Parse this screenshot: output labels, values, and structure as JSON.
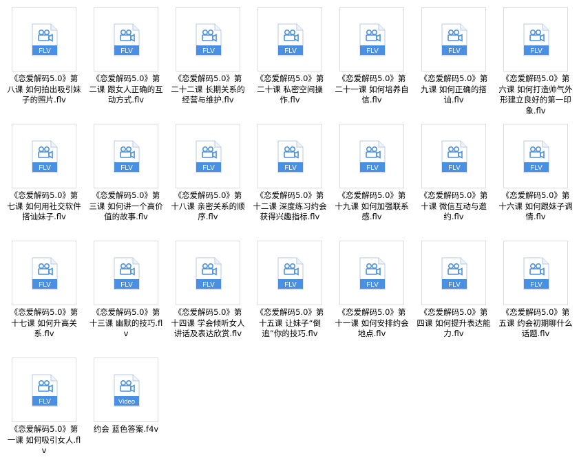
{
  "colors": {
    "icon_band": "#4a90e2",
    "icon_glyph": "#4a90e2",
    "icon_page": "#ffffff",
    "icon_border": "#b7c9e2"
  },
  "files": [
    {
      "icon": "film-camera-icon",
      "badge": "FLV",
      "name": "《恋爱解码5.0》第八课 如何拍出吸引妹子的照片.flv"
    },
    {
      "icon": "film-camera-icon",
      "badge": "FLV",
      "name": "《恋爱解码5.0》第二课 跟女人正确的互动方式.flv"
    },
    {
      "icon": "film-camera-icon",
      "badge": "FLV",
      "name": "《恋爱解码5.0》第二十二课 长期关系的经营与维护.flv"
    },
    {
      "icon": "film-camera-icon",
      "badge": "FLV",
      "name": "《恋爱解码5.0》第二十课 私密空间操作.flv"
    },
    {
      "icon": "film-camera-icon",
      "badge": "FLV",
      "name": "《恋爱解码5.0》第二十一课 如何培养自信.flv"
    },
    {
      "icon": "film-camera-icon",
      "badge": "FLV",
      "name": "《恋爱解码5.0》第九课 如何正确的搭讪.flv"
    },
    {
      "icon": "film-camera-icon",
      "badge": "FLV",
      "name": "《恋爱解码5.0》第六课 如何打造帅气外形建立良好的第一印象.flv"
    },
    {
      "icon": "film-camera-icon",
      "badge": "FLV",
      "name": "《恋爱解码5.0》第七课 如何用社交软件搭讪妹子.flv"
    },
    {
      "icon": "film-camera-icon",
      "badge": "FLV",
      "name": "《恋爱解码5.0》第三课 如何讲一个高价值的故事.flv"
    },
    {
      "icon": "film-camera-icon",
      "badge": "FLV",
      "name": "《恋爱解码5.0》第十八课 亲密关系的顺序.flv"
    },
    {
      "icon": "film-camera-icon",
      "badge": "FLV",
      "name": "《恋爱解码5.0》第十二课 深度练习约会 获得兴趣指标.flv"
    },
    {
      "icon": "film-camera-icon",
      "badge": "FLV",
      "name": "《恋爱解码5.0》第十九课 如何加强联系感.flv"
    },
    {
      "icon": "film-camera-icon",
      "badge": "FLV",
      "name": "《恋爱解码5.0》第十课 微信互动与邀约.flv"
    },
    {
      "icon": "film-camera-icon",
      "badge": "FLV",
      "name": "《恋爱解码5.0》第十六课 如何跟妹子调情.flv"
    },
    {
      "icon": "film-camera-icon",
      "badge": "FLV",
      "name": "《恋爱解码5.0》第十七课 如何升高关系.flv"
    },
    {
      "icon": "film-camera-icon",
      "badge": "FLV",
      "name": "《恋爱解码5.0》第十三课 幽默的技巧.flv"
    },
    {
      "icon": "film-camera-icon",
      "badge": "FLV",
      "name": "《恋爱解码5.0》第十四课 学会倾听女人讲话及表达欣赏.flv"
    },
    {
      "icon": "film-camera-icon",
      "badge": "FLV",
      "name": "《恋爱解码5.0》第十五课 让妹子“倒追”你的技巧.flv"
    },
    {
      "icon": "film-camera-icon",
      "badge": "FLV",
      "name": "《恋爱解码5.0》第十一课 如何安排约会地点.flv"
    },
    {
      "icon": "film-camera-icon",
      "badge": "FLV",
      "name": "《恋爱解码5.0》第四课 如何提升表达能力.flv"
    },
    {
      "icon": "film-camera-icon",
      "badge": "FLV",
      "name": "《恋爱解码5.0》第五课 约会初期聊什么话题.flv"
    },
    {
      "icon": "film-camera-icon",
      "badge": "FLV",
      "name": "《恋爱解码5.0》第一课 如何吸引女人.flv"
    },
    {
      "icon": "film-camera-icon",
      "badge": "Video",
      "name": "约会 蓝色答案.f4v"
    }
  ]
}
